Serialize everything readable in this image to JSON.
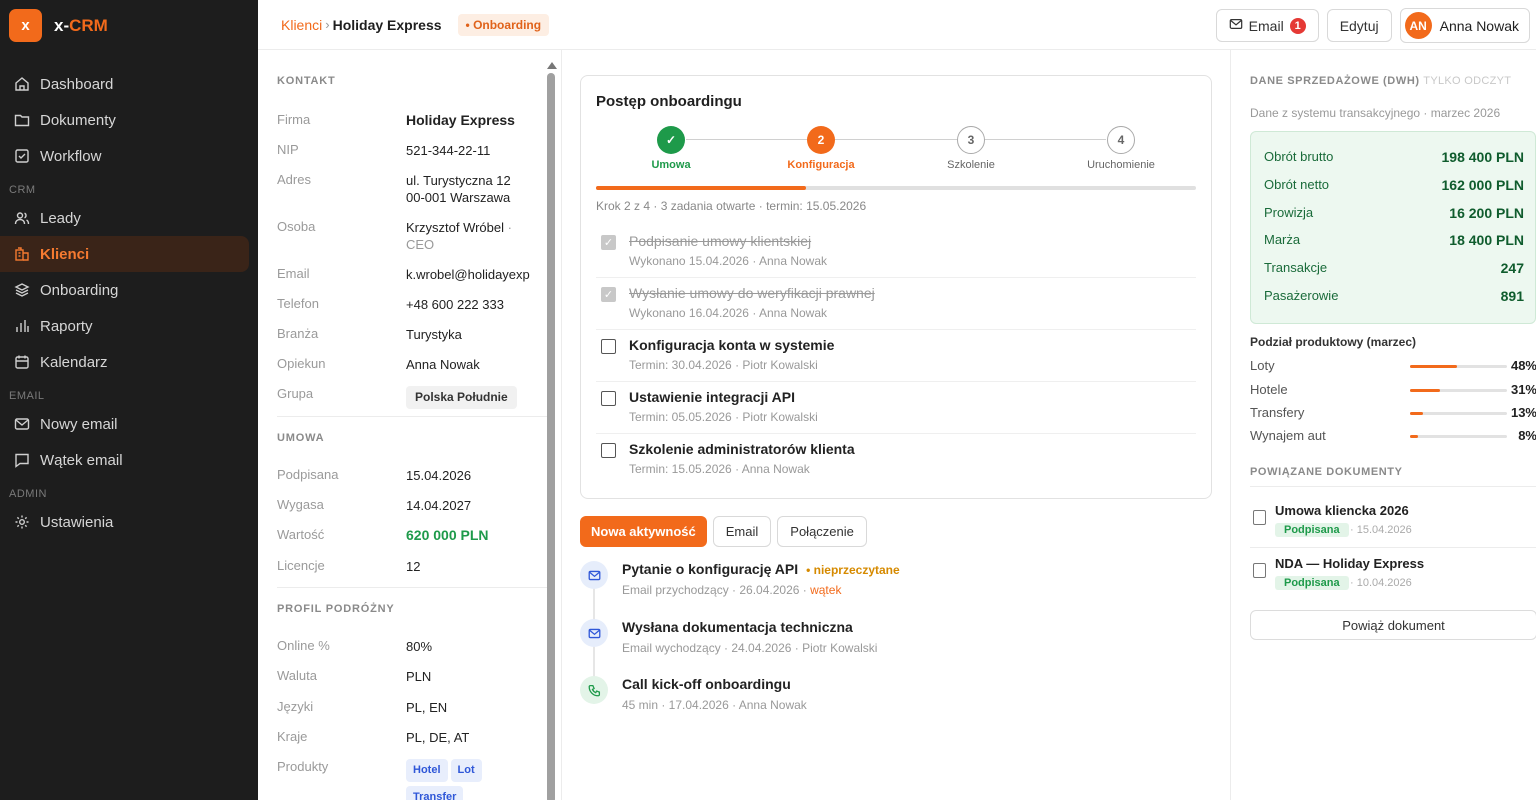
{
  "app": {
    "logo_letter": "x",
    "name_prefix": "x-",
    "name_suffix": "CRM",
    "accent": "#f26a1b"
  },
  "sidebar": {
    "items": [
      {
        "label": "Dashboard",
        "icon": "home-icon"
      },
      {
        "label": "Dokumenty",
        "icon": "folder-icon"
      },
      {
        "label": "Workflow",
        "icon": "check-square-icon"
      }
    ],
    "crm_label": "CRM",
    "crm_items": [
      {
        "label": "Leady",
        "icon": "users-icon"
      },
      {
        "label": "Klienci",
        "icon": "building-icon",
        "active": true
      },
      {
        "label": "Onboarding",
        "icon": "layers-icon"
      },
      {
        "label": "Raporty",
        "icon": "bar-chart-icon"
      },
      {
        "label": "Kalendarz",
        "icon": "calendar-icon"
      }
    ],
    "email_label": "EMAIL",
    "email_items": [
      {
        "label": "Nowy email",
        "icon": "mail-icon"
      },
      {
        "label": "Wątek email",
        "icon": "message-icon"
      }
    ],
    "admin_label": "ADMIN",
    "admin_items": [
      {
        "label": "Ustawienia",
        "icon": "gear-icon"
      }
    ]
  },
  "header": {
    "breadcrumb_parent": "Klienci",
    "breadcrumb_sep": "›",
    "breadcrumb_current": "Holiday Express",
    "status": "• Onboarding",
    "email_label": "Email",
    "email_count": "1",
    "edit_label": "Edytuj",
    "user_initials": "AN",
    "user_name": "Anna Nowak"
  },
  "info": {
    "kontakt_title": "KONTAKT",
    "firma_k": "Firma",
    "firma_v": "Holiday Express",
    "nip_k": "NIP",
    "nip_v": "521-344-22-11",
    "adres_k": "Adres",
    "adres_v1": "ul. Turystyczna 12",
    "adres_v2": "00-001 Warszawa",
    "osoba_k": "Osoba",
    "osoba_v1": "Krzysztof Wróbel",
    "osoba_sep": " ·",
    "osoba_v2": "CEO",
    "email_k": "Email",
    "email_v": "k.wrobel@holidayexp",
    "telefon_k": "Telefon",
    "telefon_v": "+48 600 222 333",
    "branza_k": "Branża",
    "branza_v": "Turystyka",
    "opiekun_k": "Opiekun",
    "opiekun_v": "Anna Nowak",
    "grupa_k": "Grupa",
    "grupa_v": "Polska Południe",
    "umowa_title": "UMOWA",
    "podpisana_k": "Podpisana",
    "podpisana_v": "15.04.2026",
    "wygasa_k": "Wygasa",
    "wygasa_v": "14.04.2027",
    "wartosc_k": "Wartość",
    "wartosc_v": "620 000 PLN",
    "licencje_k": "Licencje",
    "licencje_v": "12",
    "profil_title": "PROFIL PODRÓŻNY",
    "online_k": "Online %",
    "online_v": "80%",
    "waluta_k": "Waluta",
    "waluta_v": "PLN",
    "jezyki_k": "Języki",
    "jezyki_v": "PL, EN",
    "kraje_k": "Kraje",
    "kraje_v": "PL, DE, AT",
    "produkty_k": "Produkty",
    "produkty": [
      "Hotel",
      "Lot",
      "Transfer"
    ]
  },
  "onboarding": {
    "title": "Postęp onboardingu",
    "steps": [
      {
        "num": "✓",
        "label": "Umowa",
        "state": "done"
      },
      {
        "num": "2",
        "label": "Konfiguracja",
        "state": "current"
      },
      {
        "num": "3",
        "label": "Szkolenie",
        "state": "todo"
      },
      {
        "num": "4",
        "label": "Uruchomienie",
        "state": "todo"
      }
    ],
    "progress_fraction": 0.35,
    "caption": "Krok 2 z 4 · 3 zadania otwarte · termin: 15.05.2026",
    "tasks": [
      {
        "name": "Podpisanie umowy klientskiej",
        "sub": "Wykonano 15.04.2026 · Anna Nowak",
        "done": true
      },
      {
        "name": "Wysłanie umowy do weryfikacji prawnej",
        "sub": "Wykonano 16.04.2026 · Anna Nowak",
        "done": true
      },
      {
        "name": "Konfiguracja konta w systemie",
        "sub": "Termin: 30.04.2026 · Piotr Kowalski",
        "done": false
      },
      {
        "name": "Ustawienie integracji API",
        "sub": "Termin: 05.05.2026 · Piotr Kowalski",
        "done": false
      },
      {
        "name": "Szkolenie administratorów klienta",
        "sub": "Termin: 15.05.2026 · Anna Nowak",
        "done": false
      }
    ]
  },
  "activity": {
    "tab_new": "Nowa aktywność",
    "tab_email": "Email",
    "tab_call": "Połączenie",
    "items": [
      {
        "title": "Pytanie o konfigurację API",
        "badge": "• nieprzeczytane",
        "sub": "Email przychodzący · 26.04.2026 · ",
        "link": "wątek",
        "icon": "mail-icon"
      },
      {
        "title": "Wysłana dokumentacja techniczna",
        "sub": "Email wychodzący · 24.04.2026 · Piotr Kowalski",
        "icon": "mail-icon"
      },
      {
        "title": "Call kick-off onboardingu",
        "sub": "45 min · 17.04.2026 · Anna Nowak",
        "icon": "phone-icon"
      }
    ]
  },
  "sales": {
    "title": "DANE SPRZEDAŻOWE (DWH)",
    "readonly": "TYLKO ODCZYT",
    "subtitle": "Dane z systemu transakcyjnego · marzec 2026",
    "rows": [
      {
        "label": "Obrót brutto",
        "value": "198 400 PLN"
      },
      {
        "label": "Obrót netto",
        "value": "162 000 PLN"
      },
      {
        "label": "Prowizja",
        "value": "16 200 PLN"
      },
      {
        "label": "Marża",
        "value": "18 400 PLN"
      },
      {
        "label": "Transakcje",
        "value": "247"
      },
      {
        "label": "Pasażerowie",
        "value": "891"
      }
    ],
    "split_title": "Podział produktowy (marzec)",
    "split": [
      {
        "label": "Loty",
        "pct": "48%",
        "value": 0.48
      },
      {
        "label": "Hotele",
        "pct": "31%",
        "value": 0.31
      },
      {
        "label": "Transfery",
        "pct": "13%",
        "value": 0.13
      },
      {
        "label": "Wynajem aut",
        "pct": "8%",
        "value": 0.08
      }
    ],
    "docs_title": "POWIĄZANE DOKUMENTY",
    "docs": [
      {
        "name": "Umowa kliencka 2026",
        "status": "Podpisana",
        "date": "· 15.04.2026"
      },
      {
        "name": "NDA — Holiday Express",
        "status": "Podpisana",
        "date": "· 10.04.2026"
      }
    ],
    "link_doc": "Powiąż dokument"
  }
}
